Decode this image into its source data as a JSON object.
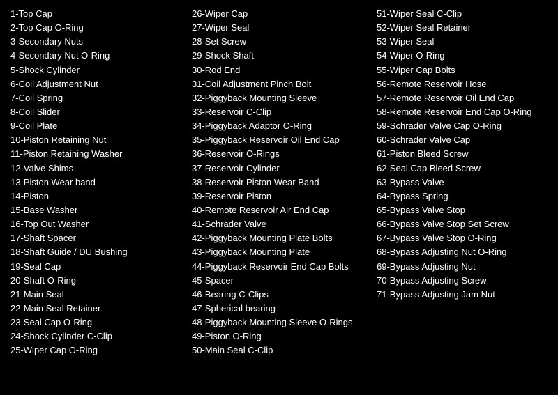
{
  "columns": {
    "col1": {
      "items": [
        "1-Top Cap",
        "2-Top Cap O-Ring",
        "3-Secondary Nuts",
        "4-Secondary Nut O-Ring",
        "5-Shock Cylinder",
        "6-Coil Adjustment Nut",
        "7-Coil Spring",
        "8-Coil Slider",
        "9-Coil Plate",
        "10-Piston Retaining Nut",
        "11-Piston Retaining Washer",
        "12-Valve Shims",
        "13-Piston Wear band",
        "14-Piston",
        "15-Base Washer",
        "16-Top Out Washer",
        "17-Shaft Spacer",
        "18-Shaft Guide / DU Bushing",
        "19-Seal Cap",
        "20-Shaft O-Ring",
        "21-Main Seal",
        "22-Main Seal Retainer",
        "23-Seal Cap O-Ring",
        "24-Shock Cylinder C-Clip",
        "25-Wiper Cap O-Ring"
      ]
    },
    "col2": {
      "items": [
        "26-Wiper Cap",
        "27-Wiper Seal",
        "28-Set Screw",
        "29-Shock Shaft",
        "30-Rod End",
        "31-Coil Adjustment Pinch Bolt",
        "32-Piggyback Mounting Sleeve",
        "33-Reservoir C-Clip",
        "34-Piggyback Adaptor O-Ring",
        "35-Piggyback Reservoir Oil End Cap",
        "36-Reservoir O-Rings",
        "37-Reservoir Cylinder",
        "38-Reservoir Piston Wear Band",
        "39-Reservoir Piston",
        "40-Remote Reservoir Air End Cap",
        "41-Schrader Valve",
        "42-Piggyback Mounting Plate Bolts",
        "43-Piggyback Mounting Plate",
        "44-Piggyback Reservoir End Cap Bolts",
        "45-Spacer",
        "46-Bearing C-Clips",
        "47-Spherical bearing",
        "48-Piggyback Mounting Sleeve O-Rings",
        "49-Piston O-Ring",
        "50-Main Seal C-Clip"
      ]
    },
    "col3": {
      "items": [
        "51-Wiper Seal C-Clip",
        "52-Wiper Seal Retainer",
        "53-Wiper Seal",
        "54-Wiper O-Ring",
        "55-Wiper Cap Bolts",
        "56-Remote Reservoir Hose",
        "57-Remote Reservoir Oil End Cap",
        "58-Remote Reservoir End Cap O-Ring",
        "59-Schrader Valve Cap O-Ring",
        "60-Schrader Valve Cap",
        "61-Piston Bleed Screw",
        "62-Seal Cap Bleed Screw",
        "63-Bypass Valve",
        "64-Bypass Spring",
        "65-Bypass Valve Stop",
        "66-Bypass Valve Stop Set Screw",
        "67-Bypass Valve Stop O-Ring",
        "68-Bypass Adjusting Nut O-Ring",
        "69-Bypass Adjusting Nut",
        "70-Bypass Adjusting Screw",
        "71-Bypass Adjusting Jam Nut"
      ]
    }
  }
}
